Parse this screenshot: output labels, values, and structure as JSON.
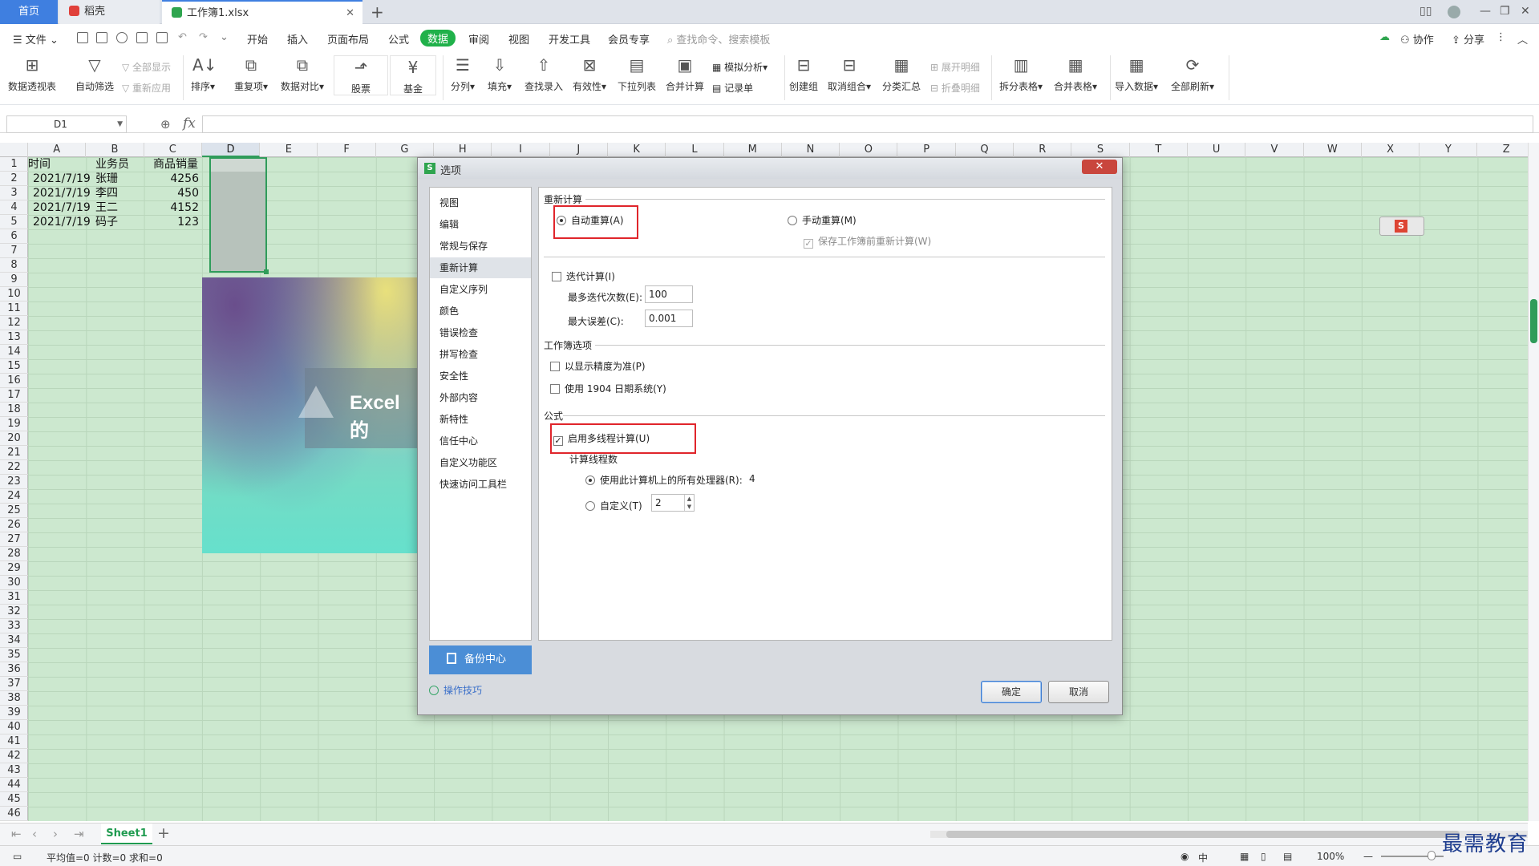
{
  "tabs": {
    "home": "首页",
    "doke": "稻壳",
    "file": "工作簿1.xlsx"
  },
  "menu": {
    "file": "文件",
    "items": [
      "开始",
      "插入",
      "页面布局",
      "公式",
      "数据",
      "审阅",
      "视图",
      "开发工具",
      "会员专享"
    ],
    "active": "数据",
    "search_placeholder": "查找命令、搜索模板",
    "collab": "协作",
    "share": "分享"
  },
  "ribbon": {
    "pivot": "数据透视表",
    "autofilter": "自动筛选",
    "show_all": "全部显示",
    "reapply": "重新应用",
    "sort": "排序",
    "duplicates": "重复项",
    "compare": "数据对比",
    "stock": "股票",
    "fund": "基金",
    "split": "分列",
    "fill": "填充",
    "find_entry": "查找录入",
    "validity": "有效性",
    "dropdown": "下拉列表",
    "consolidate": "合并计算",
    "simulate": "模拟分析",
    "record": "记录单",
    "group": "创建组",
    "ungroup": "取消组合",
    "subtotal": "分类汇总",
    "expand": "展开明细",
    "collapse": "折叠明细",
    "split_table": "拆分表格",
    "merge_table": "合并表格",
    "import": "导入数据",
    "refresh_all": "全部刷新"
  },
  "formula_bar": {
    "cell_ref": "D1",
    "fx": "fx",
    "content": ""
  },
  "sheet": {
    "columns": [
      "A",
      "B",
      "C",
      "D",
      "E",
      "F",
      "G",
      "H",
      "I",
      "J",
      "K",
      "L",
      "M",
      "N",
      "O",
      "P",
      "Q",
      "R",
      "S",
      "T",
      "U",
      "V",
      "W",
      "X",
      "Y",
      "Z"
    ],
    "selected_column": "D",
    "rows": [
      "1",
      "2",
      "3",
      "4",
      "5",
      "6",
      "7",
      "8",
      "9",
      "10",
      "11",
      "12",
      "13",
      "14",
      "15",
      "16",
      "17",
      "18",
      "19",
      "20",
      "21",
      "22",
      "23",
      "24",
      "25",
      "26",
      "27",
      "28",
      "29",
      "30",
      "31",
      "32",
      "33",
      "34",
      "35",
      "36",
      "37",
      "38",
      "39",
      "40",
      "41",
      "42",
      "43",
      "44",
      "45",
      "46"
    ],
    "headers": [
      "时间",
      "业务员",
      "商品销量"
    ],
    "data": [
      [
        "2021/7/19",
        "张珊",
        "4256"
      ],
      [
        "2021/7/19",
        "李四",
        "450"
      ],
      [
        "2021/7/19",
        "王二",
        "4152"
      ],
      [
        "2021/7/19",
        "码子",
        "123"
      ]
    ],
    "image_text": "Excel的",
    "tab_name": "Sheet1"
  },
  "status": {
    "stats": "平均值=0  计数=0  求和=0",
    "zoom": "100%",
    "ime": "中"
  },
  "watermark": "最需教育",
  "dialog": {
    "title": "选项",
    "close": "✕",
    "nav": [
      "视图",
      "编辑",
      "常规与保存",
      "重新计算",
      "自定义序列",
      "颜色",
      "错误检查",
      "拼写检查",
      "安全性",
      "外部内容",
      "新特性",
      "信任中心",
      "自定义功能区",
      "快速访问工具栏"
    ],
    "active_nav": "重新计算",
    "backup": "备份中心",
    "tips": "操作技巧",
    "recalc_title": "重新计算",
    "auto_recalc": "自动重算(A)",
    "manual_recalc": "手动重算(M)",
    "save_recalc": "保存工作簿前重新计算(W)",
    "iterate": "迭代计算(I)",
    "max_iter_label": "最多迭代次数(E):",
    "max_iter": "100",
    "max_change_label": "最大误差(C):",
    "max_change": "0.001",
    "workbook_title": "工作簿选项",
    "precision": "以显示精度为准(P)",
    "date1904": "使用 1904 日期系统(Y)",
    "formula_title": "公式",
    "multithread": "启用多线程计算(U)",
    "threads_title": "计算线程数",
    "use_all": "使用此计算机上的所有处理器(R):",
    "processors": "4",
    "custom": "自定义(T)",
    "custom_value": "2",
    "ok": "确定",
    "cancel": "取消"
  }
}
